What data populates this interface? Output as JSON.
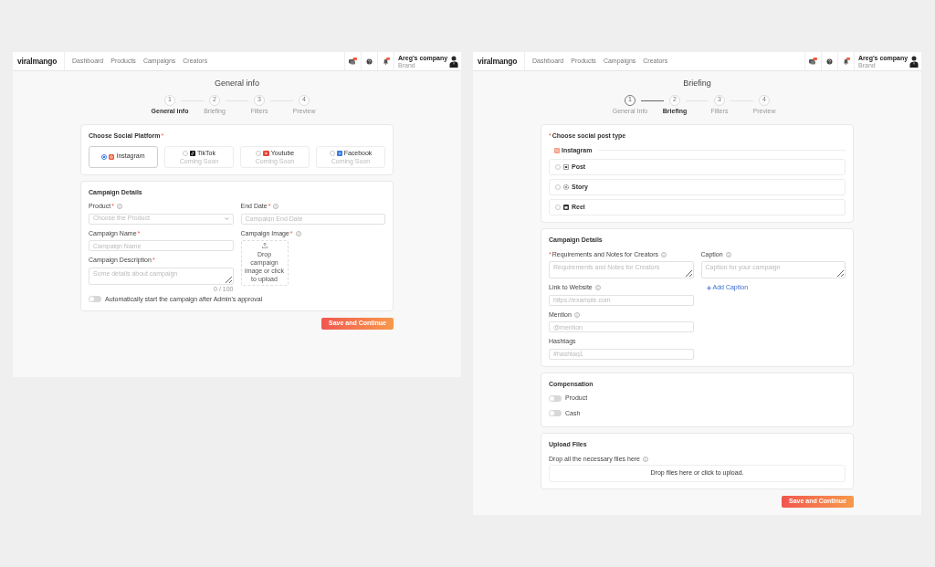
{
  "screens": [
    {
      "logo": "viralmango",
      "nav": [
        "Dashboard",
        "Products",
        "Campaigns",
        "Creators"
      ],
      "user": {
        "company": "Areg's company",
        "role": "Brand"
      },
      "title": "General info",
      "steps": [
        {
          "number": "1",
          "label": "General info",
          "selected": true,
          "done": false
        },
        {
          "number": "2",
          "label": "Briefing",
          "selected": false,
          "done": false
        },
        {
          "number": "3",
          "label": "Filters",
          "selected": false,
          "done": false
        },
        {
          "number": "4",
          "label": "Preview",
          "selected": false,
          "done": false
        }
      ],
      "cards": [
        {
          "kind": "platforms",
          "title": "Choose Social Platform",
          "mark_after": "*",
          "options": [
            {
              "label": "Instagram",
              "selected": true
            },
            {
              "label": "TikTok",
              "note": "Coming Soon",
              "selected": false
            },
            {
              "label": "Youtube",
              "note": "Coming Soon",
              "selected": false
            },
            {
              "label": "Facebook",
              "note": "Coming Soon",
              "selected": false
            }
          ]
        },
        {
          "kind": "details",
          "title": "Campaign Details",
          "columns": [
            [
              {
                "kind": "select",
                "label": "Product",
                "mark_after": "*",
                "info": true,
                "placeholder": "Choose the Product"
              },
              {
                "kind": "input",
                "label": "Campaign Name",
                "mark_after": "*",
                "placeholder": "Campaign Name"
              },
              {
                "kind": "textarea",
                "label": "Campaign Description",
                "mark_after": "*",
                "placeholder": "Some details about campaign",
                "counter": "0 / 100"
              }
            ],
            [
              {
                "kind": "input",
                "label": "End Date",
                "mark_after": "*",
                "info": true,
                "placeholder": "Campaign End Date"
              },
              {
                "kind": "image",
                "label": "Campaign Image",
                "mark_after": "*",
                "info": true,
                "text": "Drop campaign image or click to upload"
              }
            ]
          ],
          "toggle": {
            "label": "Automatically start the campaign after Admin's approval",
            "on": false
          }
        }
      ],
      "button": "Save and Continue"
    },
    {
      "logo": "viralmango",
      "nav": [
        "Dashboard",
        "Products",
        "Campaigns",
        "Creators"
      ],
      "user": {
        "company": "Areg's company",
        "role": "Brand"
      },
      "title": "Briefing",
      "steps": [
        {
          "number": "1",
          "label": "General Info",
          "selected": false,
          "done": true
        },
        {
          "number": "2",
          "label": "Briefing",
          "selected": true,
          "done": false
        },
        {
          "number": "3",
          "label": "Filters",
          "selected": false,
          "done": false
        },
        {
          "number": "4",
          "label": "Preview",
          "selected": false,
          "done": false
        }
      ],
      "cards": [
        {
          "kind": "post_types",
          "title": "Choose social post type",
          "mark_before": "*",
          "platform": "Instagram",
          "options": [
            {
              "label": "Post",
              "selected": false
            },
            {
              "label": "Story",
              "selected": false
            },
            {
              "label": "Reel",
              "selected": false
            }
          ]
        },
        {
          "kind": "details",
          "title": "Campaign Details",
          "columns": [
            [
              {
                "kind": "textarea",
                "label": "Requirements and Notes for Creators",
                "mark_before": "*",
                "info": true,
                "placeholder": "Requirements and Notes for Creators"
              },
              {
                "kind": "input",
                "label": "Link to Website",
                "info": true,
                "placeholder": "https://example.com"
              },
              {
                "kind": "input",
                "label": "Mention",
                "info": true,
                "placeholder": "@mention"
              },
              {
                "kind": "input",
                "label": "Hashtags",
                "placeholder": "#hashtag1"
              }
            ],
            [
              {
                "kind": "textarea",
                "label": "Caption",
                "info": true,
                "placeholder": "Caption for your campaign"
              },
              {
                "kind": "link",
                "label": "Add Caption"
              }
            ]
          ]
        },
        {
          "kind": "toggles",
          "title": "Compensation",
          "toggles": [
            {
              "label": "Product",
              "on": false
            },
            {
              "label": "Cash",
              "on": false
            }
          ]
        },
        {
          "kind": "upload",
          "title": "Upload Files",
          "hint": "Drop all the necessary files here",
          "dropzone": "Drop files here or click to upload."
        }
      ],
      "button": "Save and Continue"
    }
  ]
}
